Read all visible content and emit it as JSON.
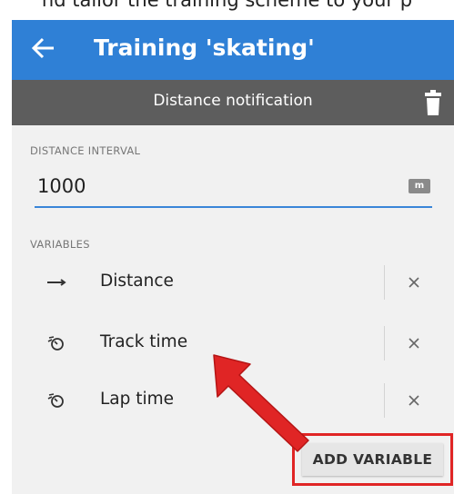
{
  "caption": "nd tailor the training scheme to your p",
  "appbar": {
    "title": "Training 'skating'",
    "back_icon": "arrow-left-icon",
    "color": "#2f80d6"
  },
  "subbar": {
    "title": "Distance notification",
    "delete_icon": "trash-icon",
    "color": "#5d5d5d"
  },
  "distance_interval": {
    "label": "DISTANCE INTERVAL",
    "value": "1000",
    "unit": "m"
  },
  "variables": {
    "label": "VARIABLES",
    "items": [
      {
        "label": "Distance",
        "icon": "arrow-right-icon"
      },
      {
        "label": "Track time",
        "icon": "stopwatch-icon"
      },
      {
        "label": "Lap time",
        "icon": "stopwatch-icon"
      }
    ],
    "remove_icon": "close-icon"
  },
  "add_button": {
    "label": "ADD VARIABLE"
  },
  "annotation": {
    "arrow_color": "#e02525",
    "highlight_color": "#e02525"
  }
}
